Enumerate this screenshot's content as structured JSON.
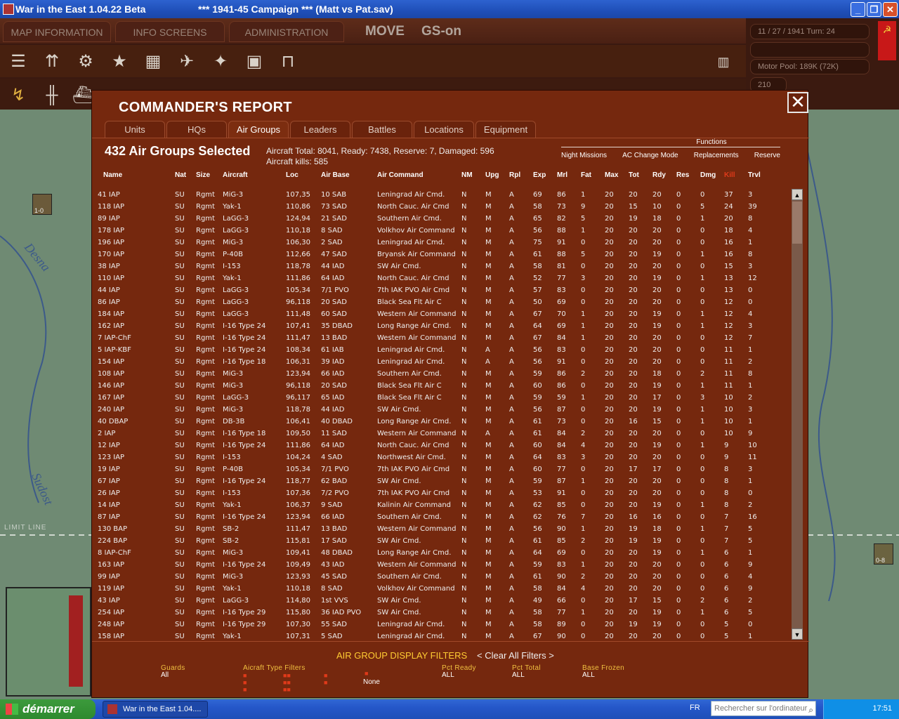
{
  "window": {
    "title": "War in the East 1.04.22 Beta",
    "file": "***   1941-45 Campaign  ***  (Matt vs Pat.sav)"
  },
  "menu": {
    "map_info": "MAP INFORMATION",
    "info_screens": "INFO SCREENS",
    "admin": "ADMINISTRATION",
    "move": "MOVE",
    "gs": "GS-on"
  },
  "status": {
    "date_turn": "11 / 27 / 1941   Turn: 24",
    "motor_pool": "Motor Pool: 189K (72K)",
    "count": "210"
  },
  "map": {
    "river1": "Desna",
    "river2": "Sudost",
    "limit": "LIMIT LINE",
    "unit1": "1-0",
    "unit2": "0-8"
  },
  "dialog": {
    "title": "COMMANDER'S REPORT",
    "tabs": [
      "Units",
      "HQs",
      "Air Groups",
      "Leaders",
      "Battles",
      "Locations",
      "Equipment"
    ],
    "selected": "432 Air Groups Selected",
    "totals": "Aircraft Total: 8041, Ready: 7438, Reserve: 7, Damaged: 596",
    "kills": "Aircraft kills: 585",
    "functions": {
      "header": "Functions",
      "items": [
        "Night Missions",
        "AC Change Mode",
        "Replacements",
        "Reserve"
      ]
    },
    "columns": [
      "Name",
      "Nat",
      "Size",
      "Aircraft",
      "Loc",
      "Air Base",
      "Air Command",
      "NM",
      "Upg",
      "Rpl",
      "Exp",
      "Mrl",
      "Fat",
      "Max",
      "Tot",
      "Rdy",
      "Res",
      "Dmg",
      "Kill",
      "Trvl"
    ],
    "filter_title": "AIR GROUP DISPLAY FILTERS",
    "clear_filters": "< Clear All Filters >",
    "filters": {
      "guards_label": "Guards",
      "guards_value": "All",
      "aircraft_label": "Aicraft   Type   Filters",
      "none": "None",
      "pct_ready_label": "Pct Ready",
      "pct_ready_value": "ALL",
      "pct_total_label": "Pct Total",
      "pct_total_value": "ALL",
      "base_frozen_label": "Base Frozen",
      "base_frozen_value": "ALL"
    }
  },
  "rows": [
    [
      "41 IAP",
      "SU",
      "Rgmt",
      "MiG-3",
      "107,35",
      "10 SAB",
      "Leningrad Air Cmd.",
      "N",
      "M",
      "A",
      "69",
      "86",
      "1",
      "20",
      "20",
      "20",
      "0",
      "0",
      "37",
      "3"
    ],
    [
      "118 IAP",
      "SU",
      "Rgmt",
      "Yak-1",
      "110,86",
      "73 SAD",
      "North Cauc. Air Cmd",
      "N",
      "M",
      "A",
      "58",
      "73",
      "9",
      "20",
      "15",
      "10",
      "0",
      "5",
      "24",
      "39"
    ],
    [
      "89 IAP",
      "SU",
      "Rgmt",
      "LaGG-3",
      "124,94",
      "21 SAD",
      "Southern Air Cmd.",
      "N",
      "M",
      "A",
      "65",
      "82",
      "5",
      "20",
      "19",
      "18",
      "0",
      "1",
      "20",
      "8"
    ],
    [
      "178 IAP",
      "SU",
      "Rgmt",
      "LaGG-3",
      "110,18",
      "8 SAD",
      "Volkhov Air Command",
      "N",
      "M",
      "A",
      "56",
      "88",
      "1",
      "20",
      "20",
      "20",
      "0",
      "0",
      "18",
      "4"
    ],
    [
      "196 IAP",
      "SU",
      "Rgmt",
      "MiG-3",
      "106,30",
      "2 SAD",
      "Leningrad Air Cmd.",
      "N",
      "M",
      "A",
      "75",
      "91",
      "0",
      "20",
      "20",
      "20",
      "0",
      "0",
      "16",
      "1"
    ],
    [
      "170 IAP",
      "SU",
      "Rgmt",
      "P-40B",
      "112,66",
      "47 SAD",
      "Bryansk Air Command",
      "N",
      "M",
      "A",
      "61",
      "88",
      "5",
      "20",
      "20",
      "19",
      "0",
      "1",
      "16",
      "8"
    ],
    [
      "38 IAP",
      "SU",
      "Rgmt",
      "I-153",
      "118,78",
      "44 IAD",
      "SW Air Cmd.",
      "N",
      "M",
      "A",
      "58",
      "81",
      "0",
      "20",
      "20",
      "20",
      "0",
      "0",
      "15",
      "3"
    ],
    [
      "110 IAP",
      "SU",
      "Rgmt",
      "Yak-1",
      "111,86",
      "64 IAD",
      "North Cauc. Air Cmd",
      "N",
      "M",
      "A",
      "52",
      "77",
      "3",
      "20",
      "20",
      "19",
      "0",
      "1",
      "13",
      "12"
    ],
    [
      "44 IAP",
      "SU",
      "Rgmt",
      "LaGG-3",
      "105,34",
      "7/1 PVO",
      "7th IAK PVO Air Cmd",
      "N",
      "M",
      "A",
      "57",
      "83",
      "0",
      "20",
      "20",
      "20",
      "0",
      "0",
      "13",
      "0"
    ],
    [
      "86 IAP",
      "SU",
      "Rgmt",
      "LaGG-3",
      "96,118",
      "20 SAD",
      "Black Sea Flt Air C",
      "N",
      "M",
      "A",
      "50",
      "69",
      "0",
      "20",
      "20",
      "20",
      "0",
      "0",
      "12",
      "0"
    ],
    [
      "184 IAP",
      "SU",
      "Rgmt",
      "LaGG-3",
      "111,48",
      "60 SAD",
      "Western Air Command",
      "N",
      "M",
      "A",
      "67",
      "70",
      "1",
      "20",
      "20",
      "19",
      "0",
      "1",
      "12",
      "4"
    ],
    [
      "162 IAP",
      "SU",
      "Rgmt",
      "I-16 Type 24",
      "107,41",
      "35 DBAD",
      "Long Range Air Cmd.",
      "N",
      "M",
      "A",
      "64",
      "69",
      "1",
      "20",
      "20",
      "19",
      "0",
      "1",
      "12",
      "3"
    ],
    [
      "7 IAP-ChF",
      "SU",
      "Rgmt",
      "I-16 Type 24",
      "111,47",
      "13 BAD",
      "Western Air Command",
      "N",
      "M",
      "A",
      "67",
      "84",
      "1",
      "20",
      "20",
      "20",
      "0",
      "0",
      "12",
      "7"
    ],
    [
      "5 IAP-KBF",
      "SU",
      "Rgmt",
      "I-16 Type 24",
      "108,34",
      "61 IAB",
      "Leningrad Air Cmd.",
      "N",
      "A",
      "A",
      "56",
      "83",
      "0",
      "20",
      "20",
      "20",
      "0",
      "0",
      "11",
      "1"
    ],
    [
      "154 IAP",
      "SU",
      "Rgmt",
      "I-16 Type 18",
      "106,31",
      "39 IAD",
      "Leningrad Air Cmd.",
      "N",
      "A",
      "A",
      "56",
      "91",
      "0",
      "20",
      "20",
      "20",
      "0",
      "0",
      "11",
      "2"
    ],
    [
      "108 IAP",
      "SU",
      "Rgmt",
      "MiG-3",
      "123,94",
      "66 IAD",
      "Southern Air Cmd.",
      "N",
      "M",
      "A",
      "59",
      "86",
      "2",
      "20",
      "20",
      "18",
      "0",
      "2",
      "11",
      "8"
    ],
    [
      "146 IAP",
      "SU",
      "Rgmt",
      "MiG-3",
      "96,118",
      "20 SAD",
      "Black Sea Flt Air C",
      "N",
      "M",
      "A",
      "60",
      "86",
      "0",
      "20",
      "20",
      "19",
      "0",
      "1",
      "11",
      "1"
    ],
    [
      "167 IAP",
      "SU",
      "Rgmt",
      "LaGG-3",
      "96,117",
      "65 IAD",
      "Black Sea Flt Air C",
      "N",
      "M",
      "A",
      "59",
      "59",
      "1",
      "20",
      "20",
      "17",
      "0",
      "3",
      "10",
      "2"
    ],
    [
      "240 IAP",
      "SU",
      "Rgmt",
      "MiG-3",
      "118,78",
      "44 IAD",
      "SW Air Cmd.",
      "N",
      "M",
      "A",
      "56",
      "87",
      "0",
      "20",
      "20",
      "19",
      "0",
      "1",
      "10",
      "3"
    ],
    [
      "40 DBAP",
      "SU",
      "Rgmt",
      "DB-3B",
      "106,41",
      "40 DBAD",
      "Long Range Air Cmd.",
      "N",
      "M",
      "A",
      "61",
      "73",
      "0",
      "20",
      "16",
      "15",
      "0",
      "1",
      "10",
      "1"
    ],
    [
      "2 IAP",
      "SU",
      "Rgmt",
      "I-16 Type 18",
      "109,50",
      "11 SAD",
      "Western Air Command",
      "N",
      "A",
      "A",
      "61",
      "84",
      "2",
      "20",
      "20",
      "20",
      "0",
      "0",
      "10",
      "9"
    ],
    [
      "12 IAP",
      "SU",
      "Rgmt",
      "I-16 Type 24",
      "111,86",
      "64 IAD",
      "North Cauc. Air Cmd",
      "N",
      "M",
      "A",
      "60",
      "84",
      "4",
      "20",
      "20",
      "19",
      "0",
      "1",
      "9",
      "10"
    ],
    [
      "123 IAP",
      "SU",
      "Rgmt",
      "I-153",
      "104,24",
      "4 SAD",
      "Northwest Air Cmd.",
      "N",
      "M",
      "A",
      "64",
      "83",
      "3",
      "20",
      "20",
      "20",
      "0",
      "0",
      "9",
      "11"
    ],
    [
      "19 IAP",
      "SU",
      "Rgmt",
      "P-40B",
      "105,34",
      "7/1 PVO",
      "7th IAK PVO Air Cmd",
      "N",
      "M",
      "A",
      "60",
      "77",
      "0",
      "20",
      "17",
      "17",
      "0",
      "0",
      "8",
      "3"
    ],
    [
      "67 IAP",
      "SU",
      "Rgmt",
      "I-16 Type 24",
      "118,77",
      "62 BAD",
      "SW Air Cmd.",
      "N",
      "M",
      "A",
      "59",
      "87",
      "1",
      "20",
      "20",
      "20",
      "0",
      "0",
      "8",
      "1"
    ],
    [
      "26 IAP",
      "SU",
      "Rgmt",
      "I-153",
      "107,36",
      "7/2 PVO",
      "7th IAK PVO Air Cmd",
      "N",
      "M",
      "A",
      "53",
      "91",
      "0",
      "20",
      "20",
      "20",
      "0",
      "0",
      "8",
      "0"
    ],
    [
      "14 IAP",
      "SU",
      "Rgmt",
      "Yak-1",
      "106,37",
      "9 SAD",
      "Kalinin Air Command",
      "N",
      "M",
      "A",
      "62",
      "85",
      "0",
      "20",
      "20",
      "19",
      "0",
      "1",
      "8",
      "2"
    ],
    [
      "87 IAP",
      "SU",
      "Rgmt",
      "I-16 Type 24",
      "123,94",
      "66 IAD",
      "Southern Air Cmd.",
      "N",
      "M",
      "A",
      "62",
      "76",
      "7",
      "20",
      "16",
      "16",
      "0",
      "0",
      "7",
      "16"
    ],
    [
      "130 BAP",
      "SU",
      "Rgmt",
      "SB-2",
      "111,47",
      "13 BAD",
      "Western Air Command",
      "N",
      "M",
      "A",
      "56",
      "90",
      "1",
      "20",
      "19",
      "18",
      "0",
      "1",
      "7",
      "5"
    ],
    [
      "224 BAP",
      "SU",
      "Rgmt",
      "SB-2",
      "115,81",
      "17 SAD",
      "SW Air Cmd.",
      "N",
      "M",
      "A",
      "61",
      "85",
      "2",
      "20",
      "19",
      "19",
      "0",
      "0",
      "7",
      "5"
    ],
    [
      "8 IAP-ChF",
      "SU",
      "Rgmt",
      "MiG-3",
      "109,41",
      "48 DBAD",
      "Long Range Air Cmd.",
      "N",
      "M",
      "A",
      "64",
      "69",
      "0",
      "20",
      "20",
      "19",
      "0",
      "1",
      "6",
      "1"
    ],
    [
      "163 IAP",
      "SU",
      "Rgmt",
      "I-16 Type 24",
      "109,49",
      "43 IAD",
      "Western Air Command",
      "N",
      "M",
      "A",
      "59",
      "83",
      "1",
      "20",
      "20",
      "20",
      "0",
      "0",
      "6",
      "9"
    ],
    [
      "99 IAP",
      "SU",
      "Rgmt",
      "MiG-3",
      "123,93",
      "45 SAD",
      "Southern Air Cmd.",
      "N",
      "M",
      "A",
      "61",
      "90",
      "2",
      "20",
      "20",
      "20",
      "0",
      "0",
      "6",
      "4"
    ],
    [
      "119 IAP",
      "SU",
      "Rgmt",
      "Yak-1",
      "110,18",
      "8 SAD",
      "Volkhov Air Command",
      "N",
      "M",
      "A",
      "58",
      "84",
      "4",
      "20",
      "20",
      "20",
      "0",
      "0",
      "6",
      "9"
    ],
    [
      "43 IAP",
      "SU",
      "Rgmt",
      "LaGG-3",
      "114,80",
      "1st VVS",
      "SW Air Cmd.",
      "N",
      "M",
      "A",
      "49",
      "66",
      "0",
      "20",
      "17",
      "15",
      "0",
      "2",
      "6",
      "2"
    ],
    [
      "254 IAP",
      "SU",
      "Rgmt",
      "I-16 Type 29",
      "115,80",
      "36 IAD PVO",
      "SW Air Cmd.",
      "N",
      "M",
      "A",
      "58",
      "77",
      "1",
      "20",
      "20",
      "19",
      "0",
      "1",
      "6",
      "5"
    ],
    [
      "248 IAP",
      "SU",
      "Rgmt",
      "I-16 Type 29",
      "107,30",
      "55 SAD",
      "Leningrad Air Cmd.",
      "N",
      "M",
      "A",
      "58",
      "89",
      "0",
      "20",
      "19",
      "19",
      "0",
      "0",
      "5",
      "0"
    ],
    [
      "158 IAP",
      "SU",
      "Rgmt",
      "Yak-1",
      "107,31",
      "5 SAD",
      "Leningrad Air Cmd.",
      "N",
      "M",
      "A",
      "67",
      "90",
      "0",
      "20",
      "20",
      "20",
      "0",
      "0",
      "5",
      "1"
    ]
  ],
  "taskbar": {
    "start": "démarrer",
    "item": "War in the East 1.04....",
    "lang": "FR",
    "search": "Rechercher sur l'ordinateur",
    "clock": "17:51"
  },
  "colors": {
    "dialog_bg": "#75280e",
    "kill_header": "#e03a1a",
    "filter_title": "#ffcc33"
  }
}
